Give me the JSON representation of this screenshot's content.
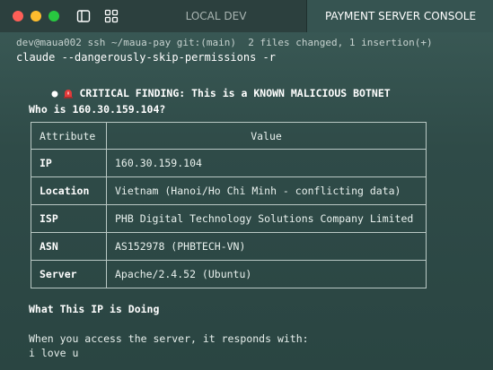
{
  "window": {
    "tabs": [
      {
        "label": "LOCAL DEV",
        "active": false
      },
      {
        "label": "PAYMENT SERVER CONSOLE",
        "active": true
      }
    ]
  },
  "terminal": {
    "prompt": "dev@maua002 ssh ~/maua-pay git:(main)  2 files changed, 1 insertion(+)",
    "command": "claude --dangerously-skip-permissions -r",
    "finding": "CRITICAL FINDING: This is a KNOWN MALICIOUS BOTNET",
    "whois_heading": "Who is 160.30.159.104?",
    "table": {
      "headers": [
        "Attribute",
        "Value"
      ],
      "rows": [
        {
          "attr": "IP",
          "value": "160.30.159.104"
        },
        {
          "attr": "Location",
          "value": "Vietnam (Hanoi/Ho Chi Minh - conflicting data)"
        },
        {
          "attr": "ISP",
          "value": "PHB Digital Technology Solutions Company Limited"
        },
        {
          "attr": "ASN",
          "value": "AS152978 (PHBTECH-VN)"
        },
        {
          "attr": "Server",
          "value": "Apache/2.4.52 (Ubuntu)"
        }
      ]
    },
    "doing_heading": "What This IP is Doing",
    "response_intro": "When you access the server, it responds with:",
    "response_body": "i love u"
  },
  "colors": {
    "background": "#2f4a47",
    "titlebar": "#2c403e",
    "active_tab": "#365451",
    "traffic_red": "#fe5f57",
    "traffic_yellow": "#febc2e",
    "traffic_green": "#28c840"
  },
  "icons": [
    "sidebar-toggle-icon",
    "grid-icon",
    "siren-icon"
  ]
}
